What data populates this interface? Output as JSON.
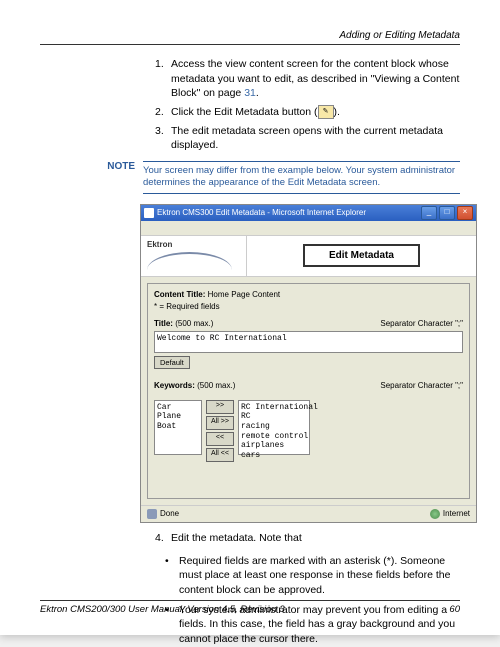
{
  "header": {
    "title": "Adding or Editing Metadata"
  },
  "steps": [
    {
      "num": "1.",
      "text_a": "Access the view content screen for the content block whose metadata you want to edit, as described in \"Viewing a Content Block\" on page ",
      "link": "31",
      "text_b": "."
    },
    {
      "num": "2.",
      "text_a": "Click the Edit Metadata button (",
      "text_b": ")."
    },
    {
      "num": "3.",
      "text_a": "The edit metadata screen opens with the current metadata displayed."
    }
  ],
  "note": {
    "label": "NOTE",
    "text": "Your screen may differ from the example below. Your system administrator determines the appearance of the Edit Metadata screen."
  },
  "browser": {
    "title": "Ektron CMS300 Edit Metadata - Microsoft Internet Explorer",
    "win_min": "_",
    "win_max": "□",
    "win_close": "×",
    "logo": "Ektron",
    "page_title": "Edit Metadata",
    "content_title_label": "Content Title:",
    "content_title_value": "Home Page Content",
    "required_note": "* = Required fields",
    "title_label": "Title:",
    "title_max": "(500 max.)",
    "sep_label": "Separator Character \";\"",
    "title_value": "Welcome to RC International",
    "default_btn": "Default",
    "keywords_label": "Keywords:",
    "keywords_max": "(500 max.)",
    "left_list": "Car\nPlane\nBoat",
    "right_list": "RC International\nRC\nracing\nremote control\nairplanes\ncars",
    "btn_one": ">>",
    "btn_all": "All >>",
    "btn_back": "<<",
    "btn_allback": "All <<",
    "status_done": "Done",
    "status_zone": "Internet"
  },
  "step4": {
    "num": "4.",
    "text": "Edit the metadata. Note that"
  },
  "bullets": [
    "Required fields are marked with an asterisk (*). Someone must place at least one response in these fields before the content block can be approved.",
    "Your system administrator may prevent you from editing a fields. In this case, the field has a gray background and you cannot place the cursor there."
  ],
  "footer": {
    "left": "Ektron CMS200/300 User Manual, Version 4.5, Revision 3",
    "right": "60"
  }
}
